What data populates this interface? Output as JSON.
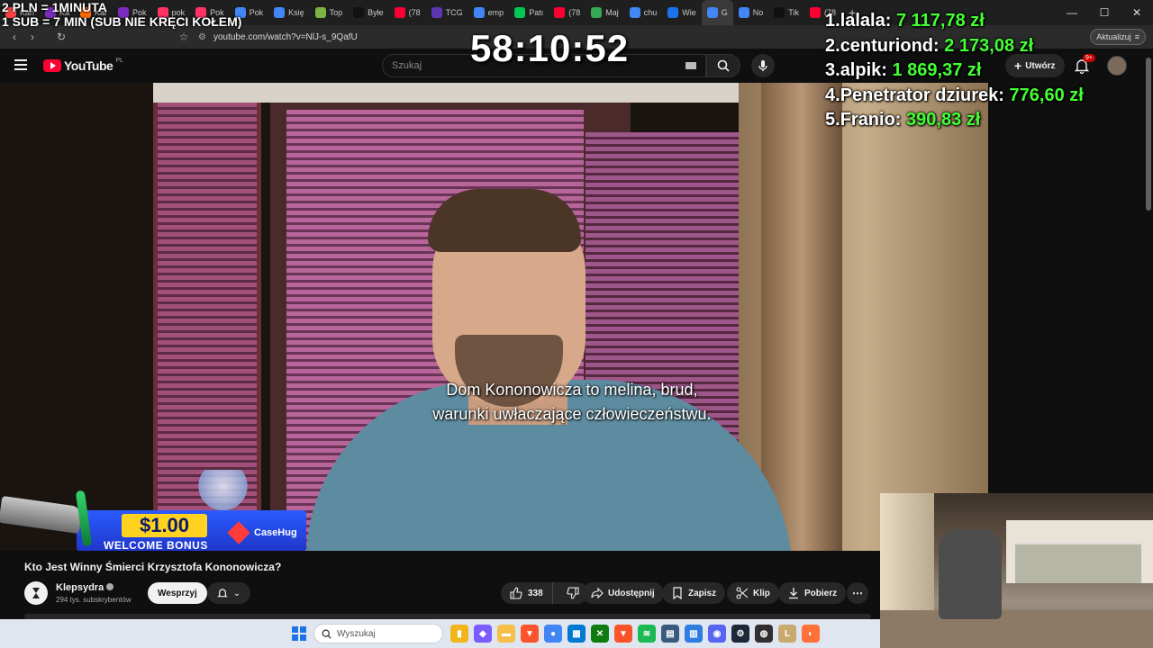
{
  "browser": {
    "tabs": [
      {
        "label": "Kan",
        "color": "#ff4444",
        "icon": "youtube-icon"
      },
      {
        "label": "Ka",
        "color": "#7b2cbf",
        "icon": "m-icon"
      },
      {
        "label": "Kar",
        "color": "#ff6b00",
        "icon": "k-icon"
      },
      {
        "label": "Pok",
        "color": "#7b2cbf",
        "icon": "m-icon"
      },
      {
        "label": "pok",
        "color": "#ff3366",
        "icon": "x-icon"
      },
      {
        "label": "Pok",
        "color": "#ff3366",
        "icon": "x-icon"
      },
      {
        "label": "Pok",
        "color": "#4285f4",
        "icon": "google-icon"
      },
      {
        "label": "Księ",
        "color": "#4285f4",
        "icon": "google-icon"
      },
      {
        "label": "Top",
        "color": "#7cb342",
        "icon": "circle-icon"
      },
      {
        "label": "Byłe",
        "color": "#111111",
        "icon": "tiktok-icon"
      },
      {
        "label": "(78",
        "color": "#ff0033",
        "icon": "youtube-icon"
      },
      {
        "label": "TCG",
        "color": "#5e35b1",
        "icon": "k-icon"
      },
      {
        "label": "emp",
        "color": "#4285f4",
        "icon": "google-icon"
      },
      {
        "label": "Patı",
        "color": "#00c853",
        "icon": "k-icon"
      },
      {
        "label": "(78",
        "color": "#ff0033",
        "icon": "youtube-icon"
      },
      {
        "label": "Maj",
        "color": "#34a853",
        "icon": "maps-icon"
      },
      {
        "label": "chu",
        "color": "#4285f4",
        "icon": "google-icon"
      },
      {
        "label": "Wie",
        "color": "#1a73e8",
        "icon": "doc-icon"
      },
      {
        "label": "G",
        "color": "#4285f4",
        "icon": "google-icon",
        "active": true
      },
      {
        "label": "No",
        "color": "#4285f4",
        "icon": "google-icon"
      },
      {
        "label": "Tik",
        "color": "#111111",
        "icon": "tiktok-icon"
      },
      {
        "label": "(78",
        "color": "#ff0033",
        "icon": "youtube-icon"
      }
    ],
    "url": "youtube.com/watch?v=NlJ-s_9QafU",
    "update_label": "Aktualizuj"
  },
  "youtube": {
    "logo_text": "YouTube",
    "country_code": "PL",
    "search_placeholder": "Szukaj",
    "create_label": "Utwórz",
    "notification_badge": "9+"
  },
  "overlay": {
    "rules_line1": "2 PLN = 1MINUTA",
    "rules_line2": "1 SUB = 7 MIN (SUB NIE KRĘCI KOŁEM)",
    "timer": "58:10:52",
    "leaderboard": [
      {
        "rank": "1.",
        "name": "lalala:",
        "amount": "7 117,78 zł"
      },
      {
        "rank": "2.",
        "name": "centuriond:",
        "amount": "2 173,08 zł"
      },
      {
        "rank": "3.",
        "name": "alpik:",
        "amount": "1 869,37 zł"
      },
      {
        "rank": "4.",
        "name": "Penetrator dziurek:",
        "amount": "776,60 zł"
      },
      {
        "rank": "5.",
        "name": "Franio:",
        "amount": "390,83 zł"
      }
    ],
    "promo_amount": "$1.00",
    "promo_welcome": "WELCOME BONUS",
    "promo_brand": "CaseHug"
  },
  "video": {
    "subtitle_line1": "Dom Kononowicza to melina, brud,",
    "subtitle_line2": "warunki uwłaczające człowieczeństwu.",
    "title": "Kto Jest Winny Śmierci Krzysztofa Kononowicza?",
    "channel_name": "Klepsydra",
    "subscribers": "294 tys. subskrybentów",
    "support_label": "Wesprzyj",
    "likes": "338",
    "share_label": "Udostępnij",
    "save_label": "Zapisz",
    "clip_label": "Klip",
    "download_label": "Pobierz",
    "more_label": "⋯"
  },
  "taskbar": {
    "search_placeholder": "Wyszukaj",
    "apps": [
      {
        "name": "file-explorer-icon",
        "color": "#f2b51c",
        "glyph": "▮"
      },
      {
        "name": "copilot-icon",
        "color": "#7a5cff",
        "glyph": "◆"
      },
      {
        "name": "folder-icon",
        "color": "#f4c04a",
        "glyph": "▬"
      },
      {
        "name": "brave-icon",
        "color": "#fb542b",
        "glyph": "▼"
      },
      {
        "name": "chrome-icon",
        "color": "#4285f4",
        "glyph": "●"
      },
      {
        "name": "store-icon",
        "color": "#0078d4",
        "glyph": "▦"
      },
      {
        "name": "xbox-icon",
        "color": "#107c10",
        "glyph": "✕"
      },
      {
        "name": "brave-active-icon",
        "color": "#fb542b",
        "glyph": "▼"
      },
      {
        "name": "spotify-icon",
        "color": "#1db954",
        "glyph": "≋"
      },
      {
        "name": "calculator-icon",
        "color": "#3a5a80",
        "glyph": "▤"
      },
      {
        "name": "calendar-icon",
        "color": "#2f7de1",
        "glyph": "▥"
      },
      {
        "name": "discord-icon",
        "color": "#5865f2",
        "glyph": "◉"
      },
      {
        "name": "steam-icon",
        "color": "#1b2838",
        "glyph": "⚙"
      },
      {
        "name": "obs-icon",
        "color": "#302e31",
        "glyph": "◍"
      },
      {
        "name": "league-icon",
        "color": "#c8aa6e",
        "glyph": "L"
      },
      {
        "name": "firefox-icon",
        "color": "#ff7139",
        "glyph": "◐"
      }
    ]
  },
  "colors": {
    "leaderboard_amount": "#44ff33",
    "youtube_red": "#ff0033",
    "background": "#0f0f0f"
  }
}
